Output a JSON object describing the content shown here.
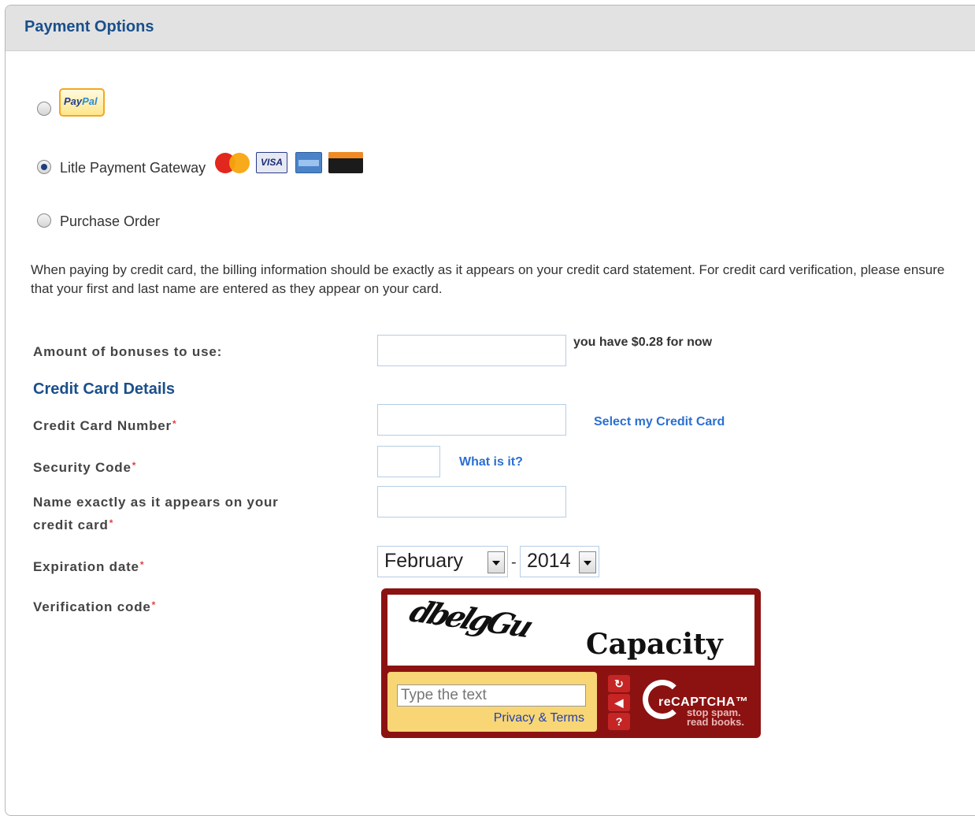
{
  "header": {
    "title": "Payment Options"
  },
  "payment_options": [
    {
      "label": "PayPal",
      "selected": false,
      "badge": [
        "Pay",
        "Pal"
      ]
    },
    {
      "label": "Litle Payment Gateway",
      "selected": true,
      "cards": [
        "mastercard-icon",
        "visa-icon",
        "amex-icon",
        "discover-icon"
      ],
      "visa_text": "VISA"
    },
    {
      "label": "Purchase Order",
      "selected": false
    }
  ],
  "info_text": "When paying by credit card, the billing information should be exactly as it appears on your credit card statement. For credit card verification, please ensure that your first and last name are entered as they appear on your card.",
  "bonuses": {
    "label": "Amount of bonuses to use:",
    "value": "",
    "note": "you have $0.28 for now"
  },
  "credit_card_section": {
    "title": "Credit Card Details",
    "card_number": {
      "label": "Credit Card Number",
      "value": "",
      "link": "Select my Credit Card"
    },
    "security_code": {
      "label": "Security Code",
      "value": "",
      "link": "What is it?"
    },
    "name_on_card": {
      "label_line1": "Name exactly as it appears on your",
      "label_line2": "credit card",
      "value": ""
    },
    "expiration": {
      "label": "Expiration date",
      "month": "February",
      "separator": "-",
      "year": "2014"
    },
    "verification": {
      "label": "Verification code"
    }
  },
  "required_marker": "*",
  "captcha": {
    "challenge_words": [
      "dbelgGu",
      "Capacity"
    ],
    "input_placeholder": "Type the text",
    "privacy_link": "Privacy & Terms",
    "brand": "reCAPTCHA™",
    "slogan_line1": "stop spam.",
    "slogan_line2": "read books."
  },
  "colors": {
    "header_title": "#1a4f8a",
    "link": "#2b6fd1",
    "required": "#e04040",
    "captcha_bg": "#8c1212",
    "captcha_panel": "#f8d676"
  }
}
